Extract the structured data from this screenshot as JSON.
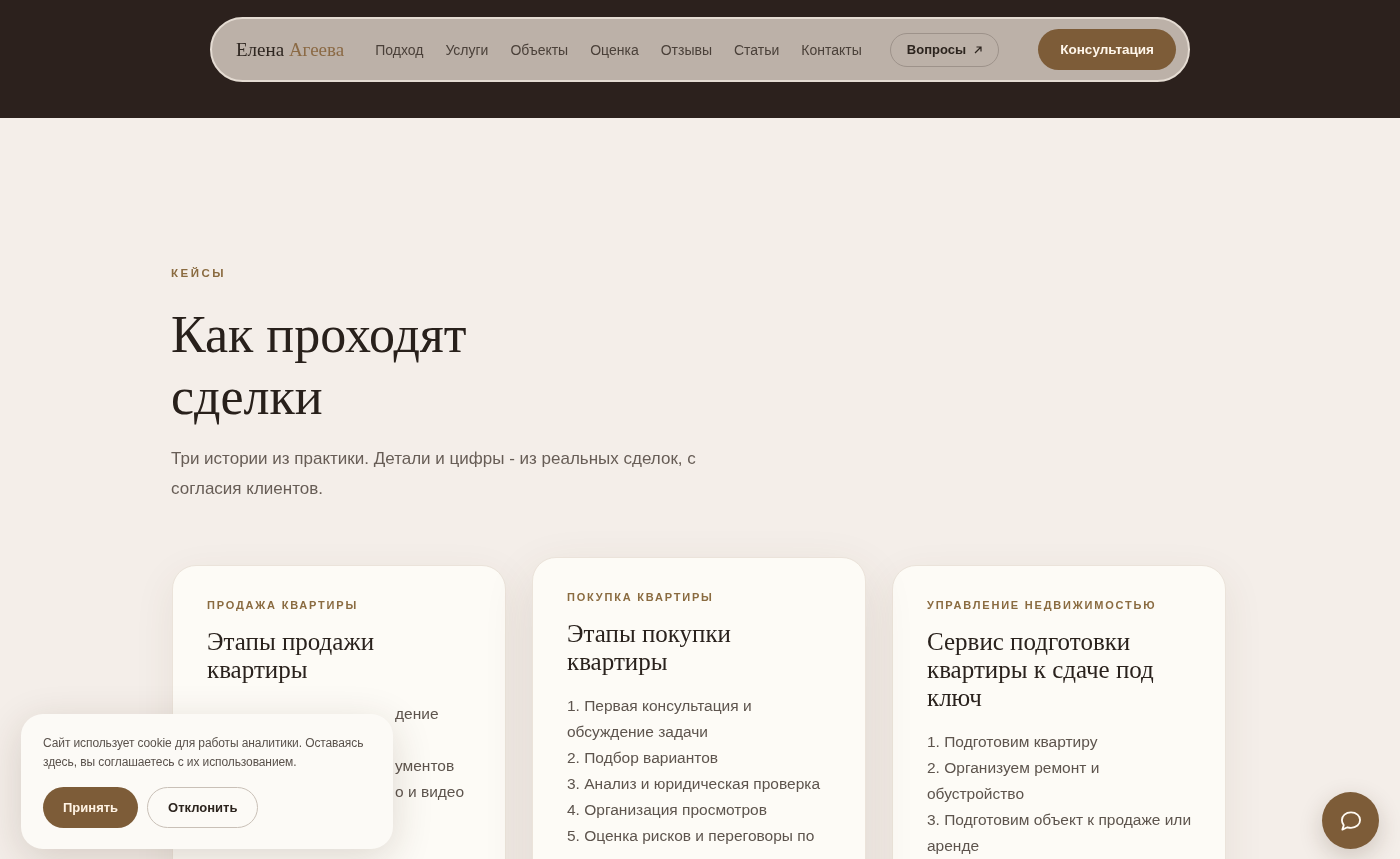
{
  "header": {
    "logo": {
      "name": "Елена",
      "surname": "Агеева"
    },
    "nav": [
      {
        "label": "Подход"
      },
      {
        "label": "Услуги"
      },
      {
        "label": "Объекты"
      },
      {
        "label": "Оценка"
      },
      {
        "label": "Отзывы"
      },
      {
        "label": "Статьи"
      },
      {
        "label": "Контакты"
      }
    ],
    "faq_button": "Вопросы",
    "cta_button": "Консультация"
  },
  "section": {
    "eyebrow": "КЕЙСЫ",
    "title": "Как проходят сделки",
    "subtitle": "Три истории из практики. Детали и цифры - из реальных сделок, с согласия клиентов."
  },
  "cards": [
    {
      "tag": "ПРОДАЖА КВАРТИРЫ",
      "title": "Этапы продажи квартиры",
      "raised": false,
      "partly_hidden": true,
      "steps": [
        "дение",
        "ументов",
        "о и видео"
      ]
    },
    {
      "tag": "ПОКУПКА КВАРТИРЫ",
      "title": "Этапы покупки квартиры",
      "raised": true,
      "partly_hidden": false,
      "steps": [
        "1. Первая консультация и обсуждение задачи",
        "2. Подбор вариантов",
        "3. Анализ и юридическая проверка",
        "4. Организация просмотров",
        "5. Оценка рисков и переговоры по"
      ]
    },
    {
      "tag": "УПРАВЛЕНИЕ НЕДВИЖИМОСТЬЮ",
      "title": "Сервис подготовки квартиры к сдаче под ключ",
      "raised": false,
      "partly_hidden": false,
      "steps": [
        "1. Подготовим квартиру",
        "2. Организуем ремонт и обустройство",
        "3. Подготовим объект к продаже или аренде"
      ]
    }
  ],
  "cookie_banner": {
    "text": "Сайт использует cookie для работы аналитики. Оставаясь здесь, вы соглашаетесь с их использованием.",
    "buttons": [
      {
        "label": "Принять",
        "kind": "primary"
      },
      {
        "label": "Отклонить",
        "kind": "secondary"
      }
    ]
  }
}
